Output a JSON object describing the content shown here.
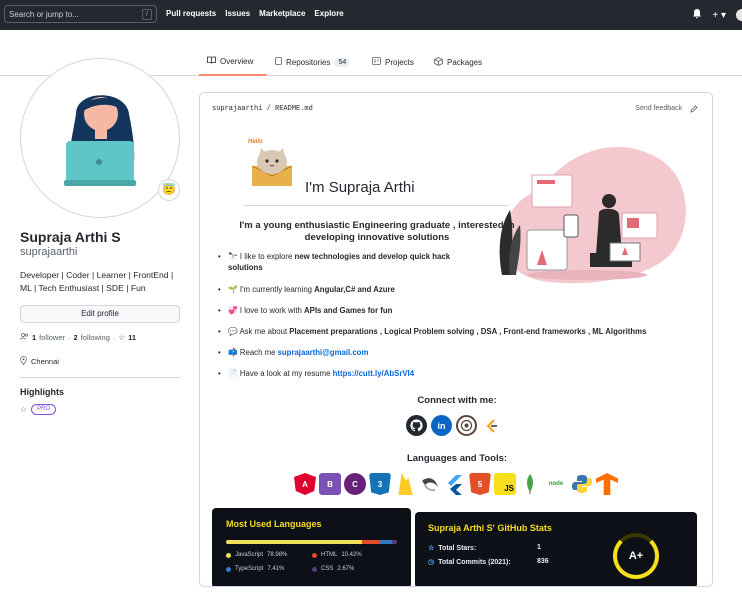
{
  "topnav": {
    "search_placeholder": "Search or jump to...",
    "slash_key": "/",
    "links": [
      "Pull requests",
      "Issues",
      "Marketplace",
      "Explore"
    ],
    "bell_icon": "bell-icon",
    "plus_label": "+ ▾"
  },
  "tabs": [
    {
      "label": "Overview",
      "icon": "book-icon"
    },
    {
      "label": "Repositories",
      "icon": "repo-icon",
      "count": "54"
    },
    {
      "label": "Projects",
      "icon": "project-icon"
    },
    {
      "label": "Packages",
      "icon": "package-icon"
    }
  ],
  "profile": {
    "name": "Supraja Arthi S",
    "username": "suprajaarthi",
    "bio": "Developer | Coder | Learner | FrontEnd | ML | Tech Enthusiast | SDE | Fun",
    "edit_label": "Edit profile",
    "followers": "1",
    "followers_label": "follower",
    "following": "2",
    "following_label": "following",
    "stars": "11",
    "location": "Chennai",
    "highlights_title": "Highlights",
    "pro_label": "PRO",
    "status_emoji": "😇"
  },
  "readme": {
    "path_user": "suprajaarthi",
    "path_file": "README.md",
    "feedback": "Send feedback",
    "hello_badge": "Hello",
    "title": "I'm Supraja Arthi",
    "intro": "I'm a young enthusiastic Engineering graduate , interested in developing innovative solutions",
    "bullets": {
      "b1_pre": "🔭 I like to explore ",
      "b1_bold": "new technologies and develop quick hack solutions",
      "b2_pre": "🌱 I'm currently learning ",
      "b2_bold": "Angular,C# and Azure",
      "b3_pre": "💞 I love to work with ",
      "b3_bold": "APIs and Games for fun",
      "b4_pre": "💬 Ask me about ",
      "b4_bold": "Placement preparations , Logical Problem solving , DSA , Front-end frameworks , ML Algorithms",
      "b5_pre": "📫 Reach me ",
      "b5_link": "suprajaarthi@gmail.com",
      "b6_pre": "📄 Have a look at my resume ",
      "b6_link": "https://cutt.ly/AbSrVI4"
    },
    "connect_title": "Connect with me:",
    "social": [
      {
        "label": "",
        "icon": "github-icon",
        "color": "#24292f"
      },
      {
        "label": "in",
        "icon": "linkedin-icon",
        "color": "#0a66c2"
      },
      {
        "label": "",
        "icon": "codechef-icon",
        "color": "#5b4638"
      },
      {
        "label": "",
        "icon": "leetcode-icon",
        "color": "#ffa116"
      }
    ],
    "languages_title": "Languages and Tools:",
    "tools": [
      {
        "label": "A",
        "icon": "angular-icon",
        "color": "#dd0031"
      },
      {
        "label": "B",
        "icon": "bootstrap-icon",
        "color": "#7952b3"
      },
      {
        "label": "C",
        "icon": "csharp-icon",
        "color": "#68217a"
      },
      {
        "label": "3",
        "icon": "css3-icon",
        "color": "#1572b6"
      },
      {
        "label": "",
        "icon": "firebase-icon",
        "color": "#ffca28"
      },
      {
        "label": "",
        "icon": "gcc-icon",
        "color": "#444444"
      },
      {
        "label": "",
        "icon": "flutter-icon",
        "color": "#02569b"
      },
      {
        "label": "5",
        "icon": "html5-icon",
        "color": "#e34f26"
      },
      {
        "label": "JS",
        "icon": "javascript-icon",
        "color": "#f7df1e"
      },
      {
        "label": "",
        "icon": "mongodb-icon",
        "color": "#47a248"
      },
      {
        "label": "node",
        "icon": "nodejs-icon",
        "color": "#339933"
      },
      {
        "label": "",
        "icon": "python-icon",
        "color": "#3776ab"
      },
      {
        "label": "",
        "icon": "tensorflow-icon",
        "color": "#ff6f00"
      }
    ],
    "languages_card": {
      "title": "Most Used Languages",
      "items": [
        {
          "name": "JavaScript",
          "pct": "78.98%",
          "value": 78.98,
          "color": "#f1e05a"
        },
        {
          "name": "HTML",
          "pct": "10.42%",
          "value": 10.42,
          "color": "#e34c26"
        },
        {
          "name": "TypeScript",
          "pct": "7.41%",
          "value": 7.41,
          "color": "#3178c6"
        },
        {
          "name": "CSS",
          "pct": "2.67%",
          "value": 2.67,
          "color": "#563d7c"
        }
      ]
    },
    "stats_card": {
      "title": "Supraja Arthi S' GitHub Stats",
      "stars_label": "Total Stars:",
      "stars_value": "1",
      "commits_label": "Total Commits (2021):",
      "commits_value": "836",
      "grade": "A+"
    }
  }
}
